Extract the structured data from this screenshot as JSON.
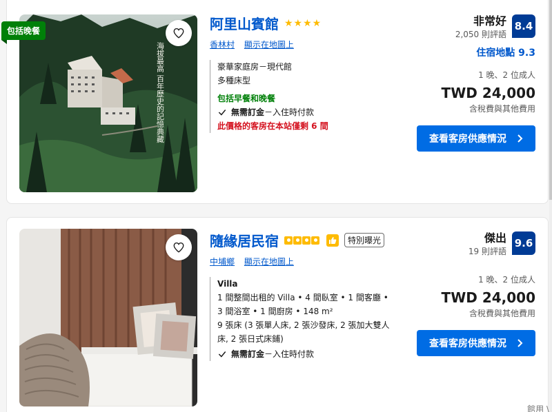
{
  "listings": [
    {
      "ribbon": "包括晚餐",
      "name": "阿里山賓館",
      "stars": "★★★★",
      "area": "香林村",
      "map_link": "顯示在地圖上",
      "image_caption": "海拔最高 百年歷史的記憶典藏",
      "room_name": "豪華家庭房－現代館",
      "bed_type": "多種床型",
      "meal_plan": "包括早餐和晚餐",
      "payment_bold": "無需訂金",
      "payment_rest": "－入住時付款",
      "scarcity": "此價格的客房在本站僅剩 6 間",
      "review_title": "非常好",
      "review_count": "2,050 則評語",
      "score": "8.4",
      "location_score": "住宿地點 9.3",
      "stay": "1 晚、2 位成人",
      "price": "TWD 24,000",
      "tax": "含稅費與其他費用",
      "cta": "查看客房供應情況"
    },
    {
      "name": "隨緣居民宿",
      "special_badge": "特別曝光",
      "area": "中埔鄉",
      "map_link": "顯示在地圖上",
      "room_name": "Villa",
      "room_desc_1": "1 間整間出租的 Villa • 4 間臥室 • 1 間客廳 •",
      "room_desc_2": "3 間浴室 • 1 間廚房 • 148 m²",
      "beds_1": "9 張床 (3 張單人床, 2 張沙發床, 2 張加大雙人",
      "beds_2": "床, 2 張日式床鋪)",
      "payment_bold": "無需訂金",
      "payment_rest": "－入住時付款",
      "review_title": "傑出",
      "review_count": "19 則評語",
      "score": "9.6",
      "stay": "1 晚、2 位成人",
      "price": "TWD 24,000",
      "tax": "含稅費與其他費用",
      "cta": "查看客房供應情況"
    }
  ],
  "corner_text": "館用 \\",
  "colors": {
    "link": "#0058cc",
    "score_bg": "#003b95",
    "cta_bg": "#006ce4",
    "green": "#008009",
    "red": "#d4111e",
    "star": "#febb02"
  },
  "icons": [
    "heart-icon",
    "chevron-right-icon",
    "check-icon",
    "thumbs-up-icon"
  ]
}
